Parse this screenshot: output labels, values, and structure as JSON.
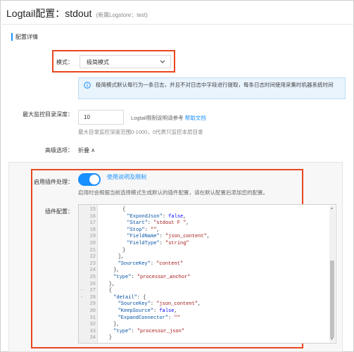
{
  "header": {
    "title": "Logtail配置：stdout",
    "subtitle": "(新属Logstore：test)"
  },
  "section": {
    "label": "配置详情"
  },
  "mode": {
    "label": "模式：",
    "value": "极简模式"
  },
  "info": {
    "text": "极简模式默认每行为一条日志，并且不对日志中字段进行提取，每条日志时间使用采集时机器系统时间"
  },
  "depth": {
    "label": "最大监控目录深度：",
    "value": "10",
    "tip_prefix": "Logtail限制说明请参考",
    "tip_link": "帮助文档",
    "help": "最大目录监控深度范围0-1000，0代表只监控本层目录"
  },
  "advanced": {
    "label": "高级选项：",
    "toggle": "折叠 ∧"
  },
  "plugin": {
    "enable_label": "启用插件处理：",
    "usage_link": "使用说明及限制",
    "tip": "启用时会根据当前选择模式生成默认的插件配置，请在默认配置后添加您的配置。",
    "config_label": "插件配置：",
    "enabled": true
  },
  "editor": {
    "lines": [
      {
        "no": "15",
        "fold": "",
        "code": "{"
      },
      {
        "no": "16",
        "fold": "",
        "code": "\"ExpondJson\": false,"
      },
      {
        "no": "17",
        "fold": "",
        "code": "\"Start\": \"stdout F \","
      },
      {
        "no": "18",
        "fold": "",
        "code": "\"Stop\": \"\","
      },
      {
        "no": "19",
        "fold": "",
        "code": "\"FieldName\": \"json_content\","
      },
      {
        "no": "20",
        "fold": "",
        "code": "\"FieldType\": \"string\""
      },
      {
        "no": "21",
        "fold": "",
        "code": "}"
      },
      {
        "no": "22",
        "fold": "",
        "code": "],"
      },
      {
        "no": "23",
        "fold": "",
        "code": "\"SourceKey\": \"content\""
      },
      {
        "no": "24",
        "fold": "",
        "code": "},"
      },
      {
        "no": "25",
        "fold": "",
        "code": "\"type\": \"processor_anchor\""
      },
      {
        "no": "26",
        "fold": "",
        "code": "},"
      },
      {
        "no": "27",
        "fold": "-",
        "code": "{"
      },
      {
        "no": "28",
        "fold": "-",
        "code": "\"detail\": {"
      },
      {
        "no": "29",
        "fold": "",
        "code": "\"SourceKey\": \"json_content\","
      },
      {
        "no": "30",
        "fold": "",
        "code": "\"KeepSource\": false,"
      },
      {
        "no": "31",
        "fold": "",
        "code": "\"ExpandConnector\": \"\""
      },
      {
        "no": "32",
        "fold": "",
        "code": "},"
      },
      {
        "no": "33",
        "fold": "",
        "code": "\"type\": \"processor_json\""
      },
      {
        "no": "34",
        "fold": "",
        "code": "}"
      }
    ]
  },
  "colors": {
    "accent": "#1890ff",
    "highlight_box": "#e8471f",
    "info_bg": "#e9f4fd"
  },
  "icons": [
    "chevron-down-icon",
    "info-icon",
    "chevron-up-icon"
  ]
}
